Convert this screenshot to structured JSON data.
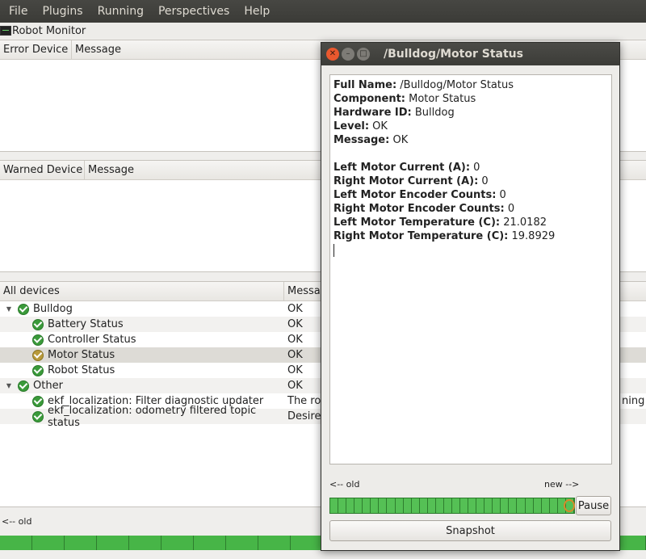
{
  "menubar": {
    "items": [
      "File",
      "Plugins",
      "Running",
      "Perspectives",
      "Help"
    ]
  },
  "monitor": {
    "title": "Robot Monitor",
    "error_pane": {
      "col_device": "Error Device",
      "col_message": "Message"
    },
    "warn_pane": {
      "col_device": "Warned Device",
      "col_message": "Message"
    },
    "tree_pane": {
      "col_device": "All devices",
      "col_message": "Message",
      "rows": [
        {
          "name": "Bulldog",
          "msg": "OK"
        },
        {
          "name": "Battery Status",
          "msg": "OK"
        },
        {
          "name": "Controller Status",
          "msg": "OK"
        },
        {
          "name": "Motor Status",
          "msg": "OK"
        },
        {
          "name": "Robot Status",
          "msg": "OK"
        },
        {
          "name": "Other",
          "msg": "OK"
        },
        {
          "name": "ekf_localization: Filter diagnostic updater",
          "msg": "The ro"
        },
        {
          "name": "ekf_localization: odometry filtered topic status",
          "msg": "Desire"
        }
      ],
      "overflow_text": "ning p"
    },
    "old_label": "<-- old"
  },
  "dialog": {
    "title": "/Bulldog/Motor Status",
    "fields": [
      {
        "key": "Full Name:",
        "value": " /Bulldog/Motor Status"
      },
      {
        "key": "Component:",
        "value": " Motor Status"
      },
      {
        "key": "Hardware ID:",
        "value": " Bulldog"
      },
      {
        "key": "Level:",
        "value": " OK"
      },
      {
        "key": "Message:",
        "value": " OK"
      }
    ],
    "values": [
      {
        "key": "Left Motor Current (A):",
        "value": " 0"
      },
      {
        "key": "Right Motor Current (A):",
        "value": " 0"
      },
      {
        "key": "Left Motor Encoder Counts:",
        "value": " 0"
      },
      {
        "key": "Right Motor Encoder Counts:",
        "value": " 0"
      },
      {
        "key": "Left Motor Temperature (C):",
        "value": " 21.0182"
      },
      {
        "key": "Right Motor Temperature (C):",
        "value": " 19.8929"
      }
    ],
    "old_label": "<-- old",
    "new_label": "new -->",
    "pause_label": "Pause",
    "snapshot_label": "Snapshot"
  }
}
